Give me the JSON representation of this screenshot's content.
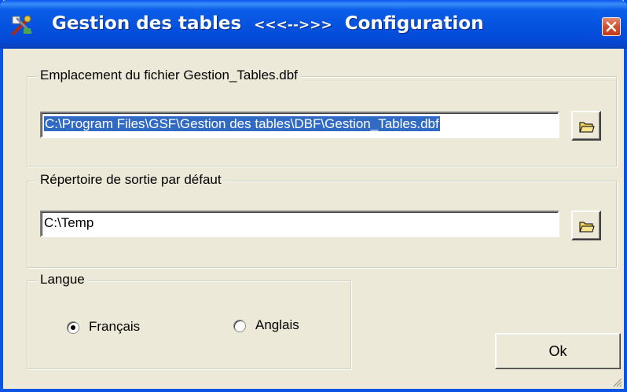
{
  "window": {
    "title_left": "Gestion des tables",
    "title_sep": "<<<-->>>",
    "title_right": "Configuration"
  },
  "file_group": {
    "legend": "Emplacement du fichier Gestion_Tables.dbf",
    "path_value": "C:\\Program Files\\GSF\\Gestion des tables\\DBF\\Gestion_Tables.dbf"
  },
  "output_group": {
    "legend": "Répertoire de sortie par défaut",
    "path_value": "C:\\Temp"
  },
  "language_group": {
    "legend": "Langue",
    "options": [
      {
        "label": "Français",
        "checked": true
      },
      {
        "label": "Anglais",
        "checked": false
      }
    ]
  },
  "ok_label": "Ok",
  "colors": {
    "titlebar": "#0450dc",
    "face": "#ece9d8",
    "selection": "#316ac5",
    "close": "#d1502e"
  },
  "icons": {
    "app": "tools-icon",
    "close": "close-icon",
    "browse": "folder-icon"
  }
}
